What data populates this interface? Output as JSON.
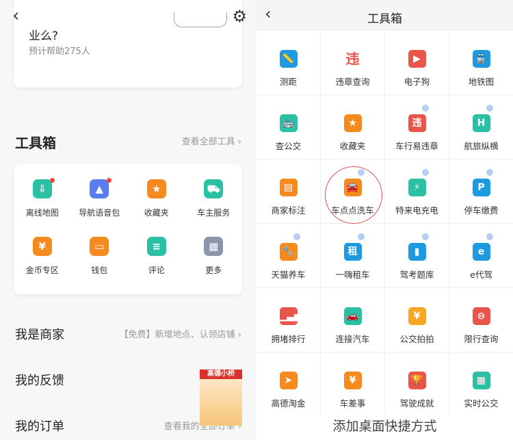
{
  "left": {
    "back_icon": "chevron-left-icon",
    "settings_icon": "gear-icon",
    "survey": {
      "question": "业么?",
      "helped": "预计帮助275人"
    },
    "toolbox": {
      "title": "工具箱",
      "more": "查看全部工具 ›",
      "items": [
        {
          "label": "离线地图",
          "color": "#2bbfa4",
          "glyph": "⇩",
          "dot": true
        },
        {
          "label": "导航语音包",
          "color": "#5b7cf0",
          "glyph": "▲",
          "dot": true
        },
        {
          "label": "收藏夹",
          "color": "#f58a1f",
          "glyph": "★",
          "dot": false
        },
        {
          "label": "车主服务",
          "color": "#2bbfa4",
          "glyph": "⛟",
          "dot": false
        },
        {
          "label": "金币专区",
          "color": "#f58a1f",
          "glyph": "¥",
          "dot": false
        },
        {
          "label": "钱包",
          "color": "#f58a1f",
          "glyph": "▭",
          "dot": false
        },
        {
          "label": "评论",
          "color": "#2bbfa4",
          "glyph": "≡",
          "dot": false
        },
        {
          "label": "更多",
          "color": "#8a96ad",
          "glyph": "▦",
          "dot": false
        }
      ]
    },
    "rows": [
      {
        "title": "我是商家",
        "right": "【免费】新增地点、认领店铺 ›"
      },
      {
        "title": "我的反馈",
        "right": ""
      },
      {
        "title": "我的订单",
        "right": "查看我的全部订单 ›"
      }
    ],
    "mascot": "高德小桥"
  },
  "right": {
    "title": "工具箱",
    "items": [
      {
        "label": "测距",
        "color": "#1e9be0",
        "glyph": "📏",
        "badge": false
      },
      {
        "label": "违章查询",
        "color": "#ffffff",
        "glyph": "违",
        "badge": false
      },
      {
        "label": "电子狗",
        "color": "#e8564b",
        "glyph": "▶",
        "badge": false
      },
      {
        "label": "地铁图",
        "color": "#1e9be0",
        "glyph": "🚆",
        "badge": false
      },
      {
        "label": "查公交",
        "color": "#2bbfa4",
        "glyph": "🚌",
        "badge": false
      },
      {
        "label": "收藏夹",
        "color": "#f58a1f",
        "glyph": "★",
        "badge": false
      },
      {
        "label": "车行易违章",
        "color": "#e8564b",
        "glyph": "违",
        "badge": true
      },
      {
        "label": "航旅纵横",
        "color": "#2bbfa4",
        "glyph": "H",
        "badge": true
      },
      {
        "label": "商家标注",
        "color": "#f58a1f",
        "glyph": "▤",
        "badge": false
      },
      {
        "label": "车点点洗车",
        "color": "#f58a1f",
        "glyph": "🚘",
        "badge": true
      },
      {
        "label": "特来电充电",
        "color": "#2bbfa4",
        "glyph": "⚡",
        "badge": true
      },
      {
        "label": "停车缴费",
        "color": "#1e9be0",
        "glyph": "P",
        "badge": true
      },
      {
        "label": "天猫养车",
        "color": "#f58a1f",
        "glyph": "🔧",
        "badge": true
      },
      {
        "label": "一嗨租车",
        "color": "#1e9be0",
        "glyph": "租",
        "badge": true
      },
      {
        "label": "驾考题库",
        "color": "#1e9be0",
        "glyph": "▮",
        "badge": true
      },
      {
        "label": "e代驾",
        "color": "#1e9be0",
        "glyph": "e",
        "badge": true
      },
      {
        "label": "拥堵排行",
        "color": "#e8564b",
        "glyph": "▁▃▅",
        "badge": false
      },
      {
        "label": "连接汽车",
        "color": "#2bbfa4",
        "glyph": "🚗",
        "badge": false
      },
      {
        "label": "公交拍拍",
        "color": "#f5a623",
        "glyph": "¥",
        "badge": false
      },
      {
        "label": "限行查询",
        "color": "#e8564b",
        "glyph": "⊖",
        "badge": false
      },
      {
        "label": "高德淘金",
        "color": "#f58a1f",
        "glyph": "➤",
        "badge": false
      },
      {
        "label": "车差事",
        "color": "#f58a1f",
        "glyph": "¥",
        "badge": false
      },
      {
        "label": "驾驶成就",
        "color": "#e8564b",
        "glyph": "🏆",
        "badge": false
      },
      {
        "label": "实时公交",
        "color": "#2bbfa4",
        "glyph": "▦",
        "badge": false
      }
    ],
    "add_shortcut": "添加桌面快捷方式"
  }
}
